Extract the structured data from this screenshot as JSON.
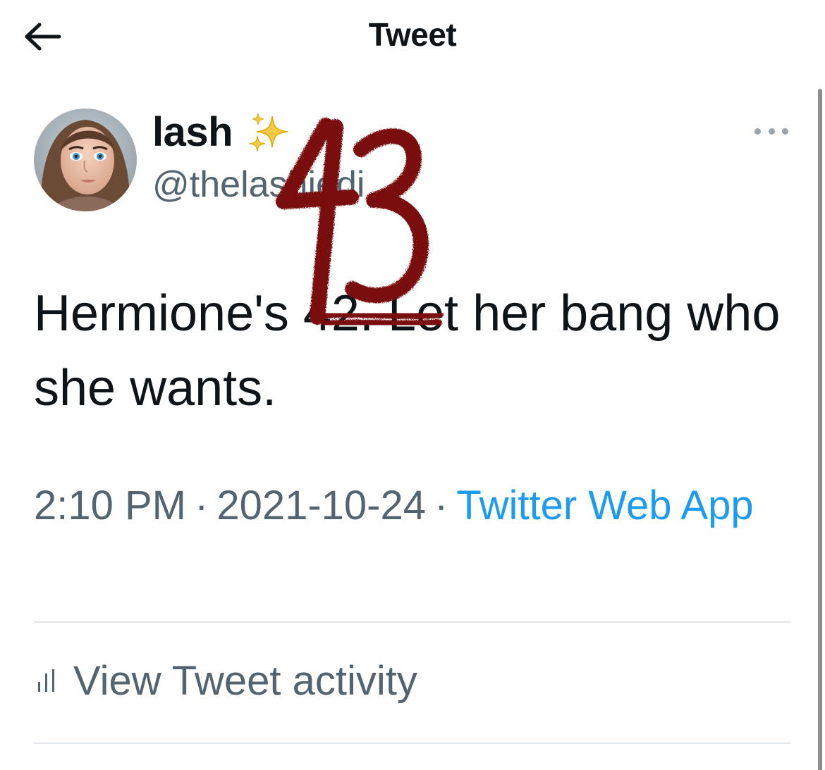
{
  "header": {
    "title": "Tweet",
    "back_icon": "arrow-left-icon"
  },
  "author": {
    "display_name": "lash",
    "name_emoji": "sparkles-icon",
    "handle": "@thelashjedi"
  },
  "tweet": {
    "text_before": "Hermione's ",
    "struck_text": "42.",
    "text_after": " Let her bang who she wants.",
    "annotation": "43"
  },
  "meta": {
    "time": "2:10 PM",
    "separator": "·",
    "date": "2021-10-24",
    "source": "Twitter Web App"
  },
  "actions": {
    "activity_label": "View Tweet activity",
    "activity_icon": "bar-chart-icon"
  },
  "colors": {
    "text": "#0f1419",
    "secondary": "#536471",
    "link": "#1d9bf0",
    "annotation": "#7a1010"
  }
}
